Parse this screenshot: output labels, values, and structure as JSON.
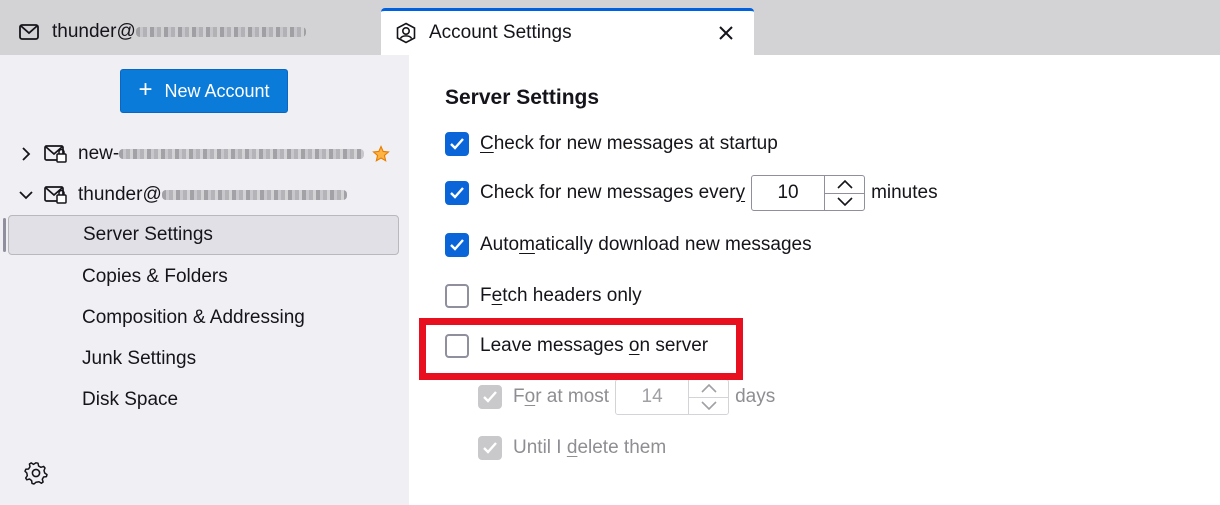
{
  "tabs": [
    {
      "label": "thunder@",
      "icon": "mail-envelope-icon",
      "redacted": true
    },
    {
      "label": "Account Settings",
      "icon": "account-settings-icon",
      "close": "close-icon"
    }
  ],
  "sidebar": {
    "new_account_label": "New Account",
    "accounts": [
      {
        "name": "new-",
        "expanded": false,
        "starred": true
      },
      {
        "name": "thunder@",
        "expanded": true
      }
    ],
    "items": [
      {
        "label": "Server Settings",
        "selected": true
      },
      {
        "label": "Copies & Folders"
      },
      {
        "label": "Composition & Addressing"
      },
      {
        "label": "Junk Settings"
      },
      {
        "label": "Disk Space"
      }
    ]
  },
  "main": {
    "title": "Server Settings",
    "options": {
      "startup": {
        "pre": "",
        "ul": "C",
        "post": "heck for new messages at startup",
        "checked": true
      },
      "every": {
        "pre": "Check for new messages ever",
        "ul": "y",
        "post": "",
        "value": "10",
        "suffix": "minutes",
        "checked": true
      },
      "auto": {
        "pre": "Auto",
        "ul": "m",
        "post": "atically download new messages",
        "checked": true
      },
      "headers": {
        "pre": "F",
        "ul": "e",
        "post": "tch headers only",
        "checked": false
      },
      "leave": {
        "pre": "Leave messages ",
        "ul": "o",
        "post": "n server",
        "checked": false
      },
      "atmost": {
        "pre": "F",
        "ul": "o",
        "post": "r at most",
        "value": "14",
        "suffix": "days",
        "checked": true,
        "disabled": true
      },
      "until": {
        "pre": "Until I ",
        "ul": "d",
        "post": "elete them",
        "checked": true,
        "disabled": true
      }
    }
  },
  "colors": {
    "accent": "#0a66d8",
    "highlight": "#e8101f",
    "tab_indicator": "#0061e0"
  }
}
